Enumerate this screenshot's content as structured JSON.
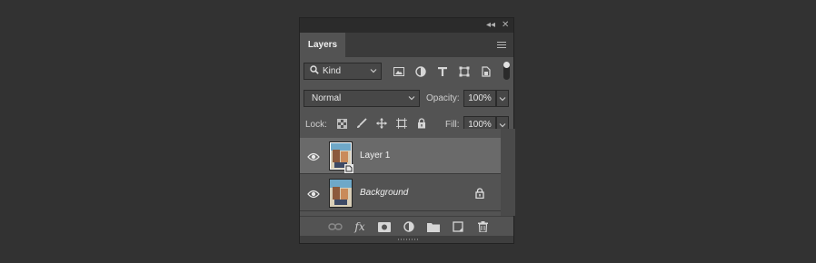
{
  "panel": {
    "tab_label": "Layers",
    "collapse_glyph": "◂◂",
    "close_glyph": "✕"
  },
  "filter": {
    "kind_label": "Kind",
    "icons": [
      "image-filter-icon",
      "adjustment-filter-icon",
      "type-filter-icon",
      "shape-filter-icon",
      "smart-object-filter-icon"
    ]
  },
  "blend": {
    "mode": "Normal",
    "opacity_label": "Opacity:",
    "opacity_value": "100%"
  },
  "lock": {
    "label": "Lock:",
    "fill_label": "Fill:",
    "fill_value": "100%"
  },
  "layers": [
    {
      "name": "Layer 1",
      "selected": true,
      "visible": true,
      "locked": false,
      "smart_object": true
    },
    {
      "name": "Background",
      "selected": false,
      "visible": true,
      "locked": true,
      "smart_object": false
    }
  ],
  "footer": {
    "fx_label": "fx",
    "icons": [
      "link-layers-icon",
      "fx-icon",
      "add-mask-icon",
      "new-adjustment-icon",
      "new-group-icon",
      "new-layer-icon",
      "delete-layer-icon"
    ]
  },
  "colors": {
    "panel_bg": "#535353",
    "selected_row": "#6a6a6a",
    "app_bg": "#323232"
  }
}
